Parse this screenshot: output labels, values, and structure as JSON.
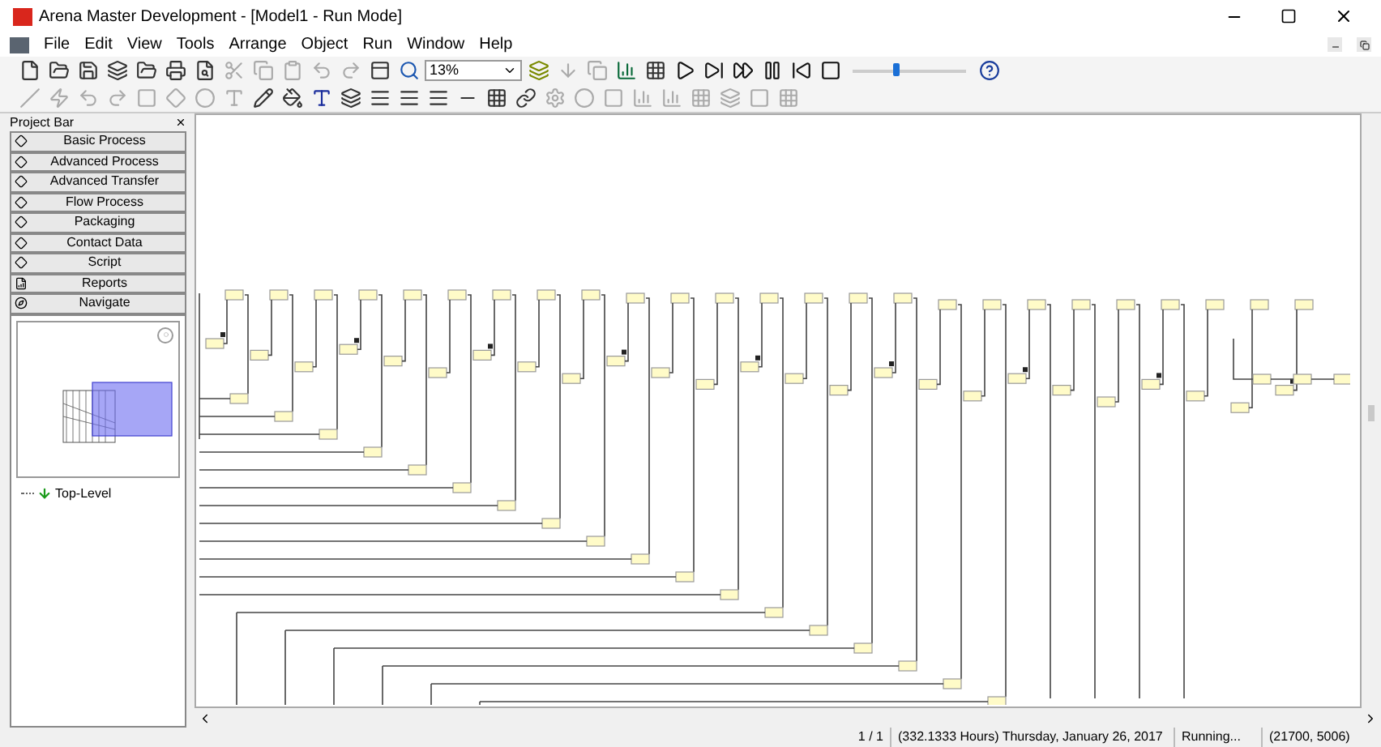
{
  "window": {
    "title": "Arena Master Development - [Model1 - Run Mode]"
  },
  "menu": [
    "File",
    "Edit",
    "View",
    "Tools",
    "Arrange",
    "Object",
    "Run",
    "Window",
    "Help"
  ],
  "toolbar": {
    "zoom": "13%",
    "speed": {
      "level": 0.38
    }
  },
  "project_bar": {
    "title": "Project Bar",
    "panels": [
      {
        "label": "Basic Process",
        "kind": "template"
      },
      {
        "label": "Advanced Process",
        "kind": "template"
      },
      {
        "label": "Advanced Transfer",
        "kind": "template"
      },
      {
        "label": "Flow Process",
        "kind": "template"
      },
      {
        "label": "Packaging",
        "kind": "template"
      },
      {
        "label": "Contact Data",
        "kind": "template"
      },
      {
        "label": "Script",
        "kind": "template"
      },
      {
        "label": "Reports",
        "kind": "reports"
      },
      {
        "label": "Navigate",
        "kind": "navigate"
      }
    ]
  },
  "navigate": {
    "tree": [
      {
        "label": "Top-Level"
      }
    ]
  },
  "status_bar": {
    "page": "1 / 1",
    "time": "(332.1333 Hours) Thursday, January 26, 2017",
    "state": "Running...",
    "coords": "(21700, 5006)"
  }
}
